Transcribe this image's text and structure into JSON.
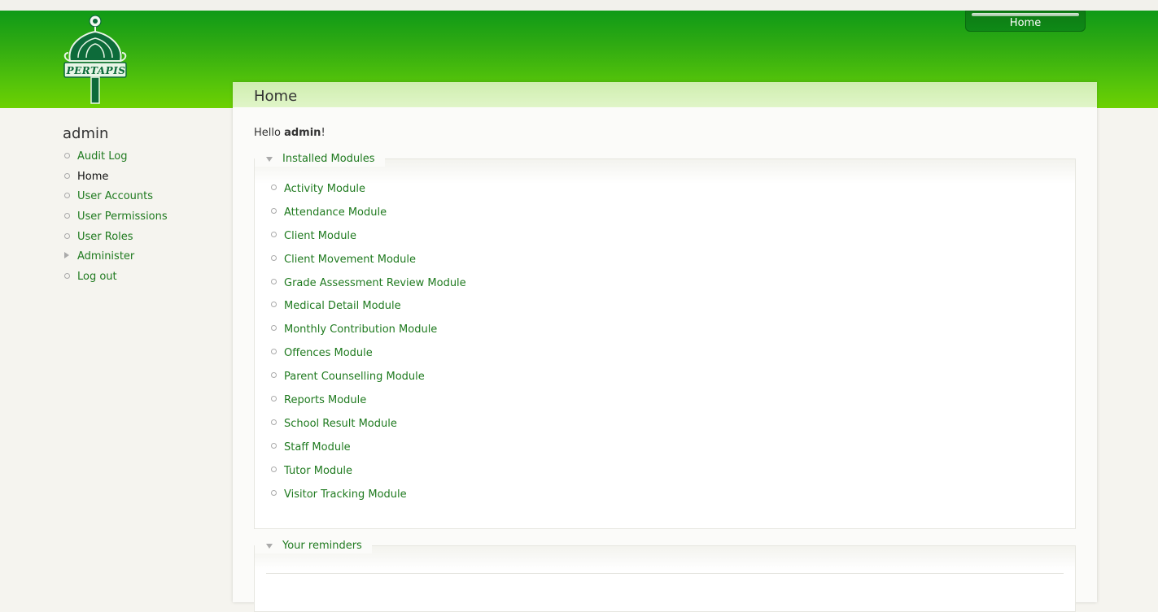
{
  "header": {
    "logo_text": "PERTAPIS",
    "tab_label": "Home"
  },
  "sidebar": {
    "title": "admin",
    "items": [
      {
        "label": "Audit Log",
        "type": "bullet",
        "active": false
      },
      {
        "label": "Home",
        "type": "bullet",
        "active": true
      },
      {
        "label": "User Accounts",
        "type": "bullet",
        "active": false
      },
      {
        "label": "User Permissions",
        "type": "bullet",
        "active": false
      },
      {
        "label": "User Roles",
        "type": "bullet",
        "active": false
      },
      {
        "label": "Administer",
        "type": "collapsed",
        "active": false
      },
      {
        "label": "Log out",
        "type": "bullet",
        "active": false
      }
    ]
  },
  "main": {
    "page_title": "Home",
    "greeting_prefix": "Hello",
    "greeting_user": "admin",
    "greeting_suffix": "!",
    "installed_modules": {
      "legend": "Installed Modules",
      "items": [
        "Activity Module",
        "Attendance Module",
        "Client Module",
        "Client Movement Module",
        "Grade Assessment Review Module",
        "Medical Detail Module",
        "Monthly Contribution Module",
        "Offences Module",
        "Parent Counselling Module",
        "Reports Module",
        "School Result Module",
        "Staff Module",
        "Tutor Module",
        "Visitor Tracking Module"
      ]
    },
    "reminders": {
      "legend": "Your reminders"
    }
  },
  "colors": {
    "header_top": "#0f9a17",
    "header_bottom": "#6dd102",
    "link": "#1f7a1f",
    "title_bar": "#d6f1bb"
  }
}
